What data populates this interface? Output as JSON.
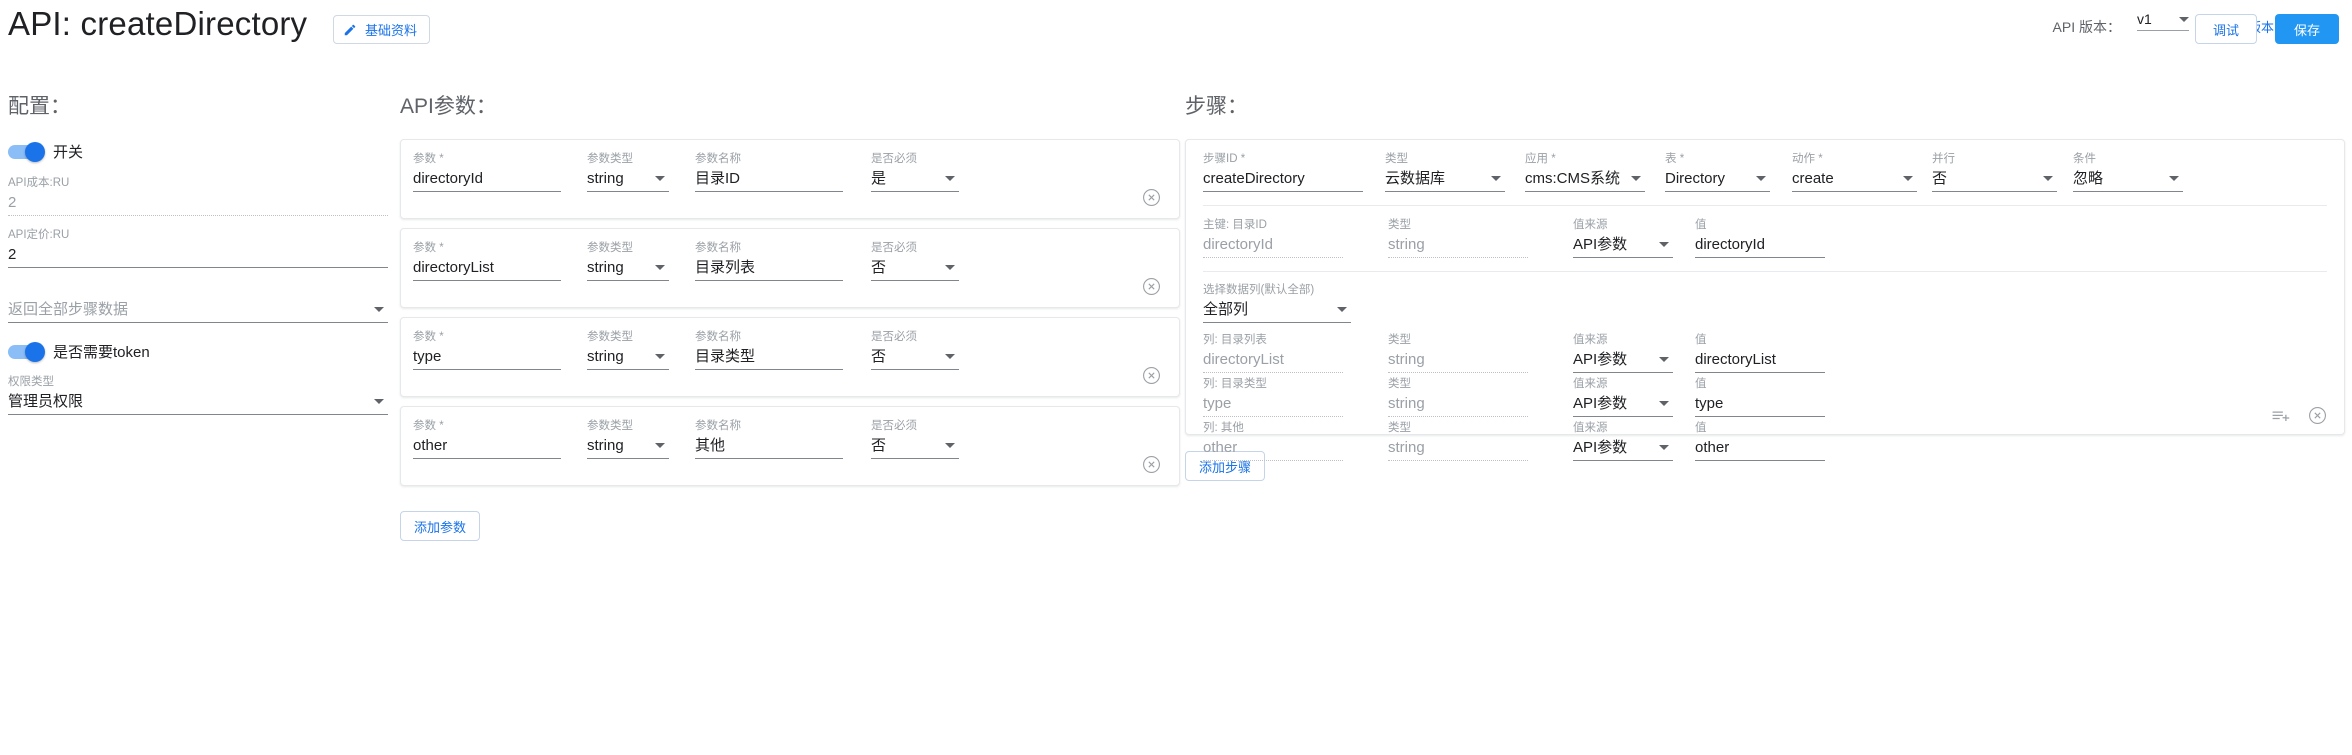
{
  "header": {
    "title": "API: createDirectory",
    "basic_info_button": "基础资料",
    "version_label": "API 版本：",
    "version_value": "v1",
    "new_version_link": "+ 创建新版本",
    "debug_button": "调试",
    "save_button": "保存"
  },
  "config": {
    "title": "配置：",
    "switch_label": "开关",
    "cost_label": "API成本:RU",
    "cost_value": "2",
    "price_label": "API定价:RU",
    "price_value": "2",
    "return_select": "返回全部步骤数据",
    "token_label": "是否需要token",
    "auth_label": "权限类型",
    "auth_value": "管理员权限"
  },
  "params": {
    "title": "API参数：",
    "labels": {
      "name": "参数 *",
      "type": "参数类型",
      "display": "参数名称",
      "required": "是否必须"
    },
    "add_button": "添加参数",
    "rows": [
      {
        "name": "directoryId",
        "type": "string",
        "display": "目录ID",
        "required": "是"
      },
      {
        "name": "directoryList",
        "type": "string",
        "display": "目录列表",
        "required": "否"
      },
      {
        "name": "type",
        "type": "string",
        "display": "目录类型",
        "required": "否"
      },
      {
        "name": "other",
        "type": "string",
        "display": "其他",
        "required": "否"
      }
    ]
  },
  "steps": {
    "title": "步骤：",
    "add_button": "添加步骤",
    "head": {
      "step_id_label": "步骤ID *",
      "step_id_value": "createDirectory",
      "type_label": "类型",
      "type_value": "云数据库",
      "app_label": "应用 *",
      "app_value": "cms:CMS系统",
      "table_label": "表 *",
      "table_value": "Directory",
      "action_label": "动作 *",
      "action_value": "create",
      "parallel_label": "并行",
      "parallel_value": "否",
      "condition_label": "条件",
      "condition_value": "忽略"
    },
    "primary_key": {
      "key_label": "主键: 目录ID",
      "key_value": "directoryId",
      "type_label": "类型",
      "type_value": "string",
      "source_label": "值来源",
      "source_value": "API参数",
      "value_label": "值",
      "value_value": "directoryId"
    },
    "columns_select": {
      "label": "选择数据列(默认全部)",
      "value": "全部列"
    },
    "column_rows": [
      {
        "key_label": "列: 目录列表",
        "key_value": "directoryList",
        "type_label": "类型",
        "type_value": "string",
        "source_label": "值来源",
        "source_value": "API参数",
        "value_label": "值",
        "value_value": "directoryList"
      },
      {
        "key_label": "列: 目录类型",
        "key_value": "type",
        "type_label": "类型",
        "type_value": "string",
        "source_label": "值来源",
        "source_value": "API参数",
        "value_label": "值",
        "value_value": "type"
      },
      {
        "key_label": "列: 其他",
        "key_value": "other",
        "type_label": "类型",
        "type_value": "string",
        "source_label": "值来源",
        "source_value": "API参数",
        "value_label": "值",
        "value_value": "other"
      }
    ]
  },
  "colors": {
    "accent": "#1a73e8",
    "save_bg": "#2196f3",
    "label_gray": "#9aa0a6",
    "text": "#202124"
  }
}
